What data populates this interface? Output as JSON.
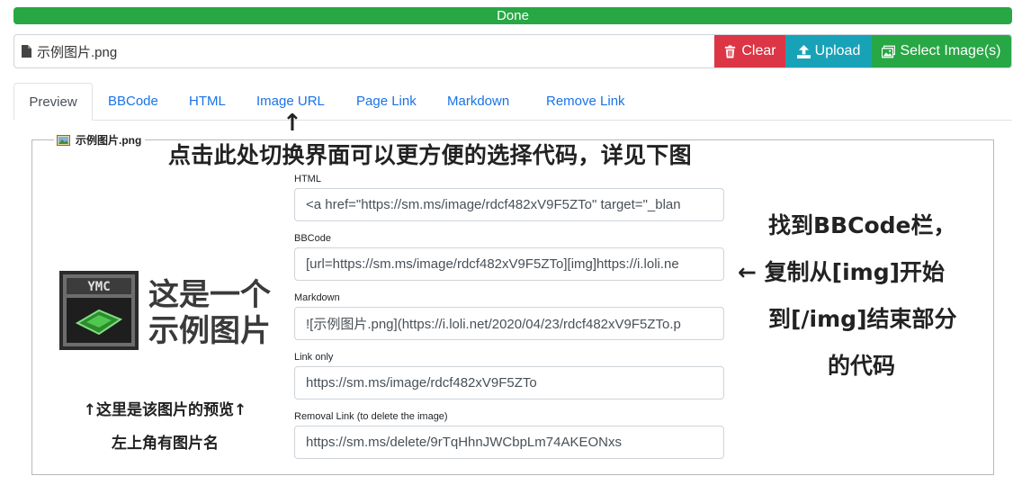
{
  "progress": {
    "label": "Done"
  },
  "file": {
    "name": "示例图片.png"
  },
  "buttons": {
    "clear": "Clear",
    "upload": "Upload",
    "select": "Select Image(s)"
  },
  "tabs": [
    "Preview",
    "BBCode",
    "HTML",
    "Image URL",
    "Page Link",
    "Markdown",
    "Remove Link"
  ],
  "preview": {
    "legend": "示例图片.png",
    "image_text_line1": "这是一个",
    "image_text_line2": "示例图片",
    "logo_label": "YMC"
  },
  "fields": [
    {
      "label": "HTML",
      "value": "<a href=\"https://sm.ms/image/rdcf482xV9F5ZTo\" target=\"_blan"
    },
    {
      "label": "BBCode",
      "value": "[url=https://sm.ms/image/rdcf482xV9F5ZTo][img]https://i.loli.ne"
    },
    {
      "label": "Markdown",
      "value": "![示例图片.png](https://i.loli.net/2020/04/23/rdcf482xV9F5ZTo.p"
    },
    {
      "label": "Link only",
      "value": "https://sm.ms/image/rdcf482xV9F5ZTo"
    },
    {
      "label": "Removal Link (to delete the image)",
      "value": "https://sm.ms/delete/9rTqHhnJWCbpLm74AKEONxs"
    }
  ],
  "annotations": {
    "tab_arrow": "↑",
    "top": "点击此处切换界面可以更方便的选择代码，详见下图",
    "right_line1": "找到BBCode栏，",
    "right_line2": "← 复制从[img]开始",
    "right_line3": "到[/img]结束部分",
    "right_line4": "的代码",
    "preview_line1": "↑这里是该图片的预览↑",
    "preview_line2": "左上角有图片名"
  },
  "colors": {
    "success": "#28a745",
    "danger": "#dc3545",
    "info": "#17a2b8",
    "link": "#1a73e8"
  }
}
